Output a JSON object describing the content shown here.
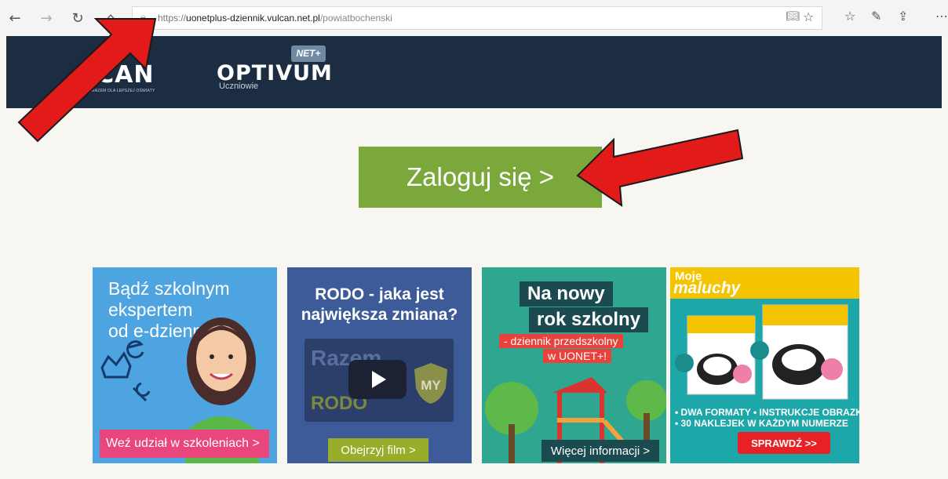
{
  "browser": {
    "address": {
      "scheme": "https://",
      "host": "uonetplus-dziennik.vulcan.net.pl",
      "path": "/powiatbochenski"
    }
  },
  "header": {
    "logo_left_text": "LCAN",
    "logo_left_subtitle": "RAZEM DLA LEPSZEJ OŚWIATY",
    "logo_right_text": "OPTIVUM",
    "logo_right_badge": "NET+",
    "logo_right_subtitle": "Uczniowie"
  },
  "login": {
    "label": "Zaloguj się >"
  },
  "banners": [
    {
      "title_lines": [
        "Bądź szkolnym",
        "ekspertem",
        "od e-dziennika"
      ],
      "cta": "Weź udział w szkoleniach >"
    },
    {
      "title_lines": [
        "RODO - jaka jest",
        "największa zmiana?"
      ],
      "video_text_1": "Razem",
      "video_text_2": "RODO",
      "video_badge": "MY",
      "cta": "Obejrzyj film >"
    },
    {
      "title_lines": [
        "Na nowy",
        "rok szkolny"
      ],
      "subtitle_lines": [
        "- dziennik przedszkolny",
        "w UONET+!"
      ],
      "cta": "Więcej informacji >"
    },
    {
      "logo_lines": [
        "Moje",
        "maluchy"
      ],
      "features": [
        "• DWA FORMATY  • INSTRUKCJE OBRAZKOWE",
        "• 30 NAKLEJEK W KAŻDYM NUMERZE"
      ],
      "cta": "SPRAWDŹ >>"
    }
  ],
  "colors": {
    "header_bg": "#1c2d41",
    "login_bg": "#7aa83a",
    "arrow": "#e21a1a"
  }
}
